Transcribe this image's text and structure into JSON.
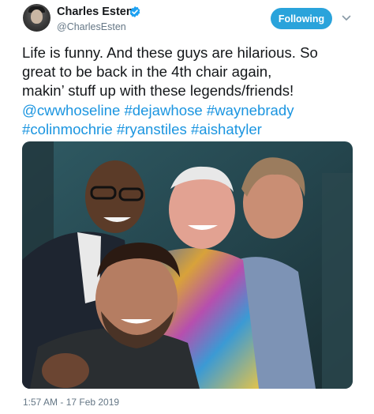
{
  "author": {
    "display_name": "Charles Esten",
    "handle": "@CharlesEsten",
    "verified": true
  },
  "follow_button_label": "Following",
  "tweet": {
    "lines": [
      [
        {
          "text": "Life is funny. And these guys are hilarious. So",
          "tag": false
        }
      ],
      [
        {
          "text": "great to be back in the 4th chair again,",
          "tag": false
        }
      ],
      [
        {
          "text": "makin’ stuff up with these legends/friends!",
          "tag": false
        }
      ],
      [
        {
          "text": "@cwwhoseline",
          "tag": true
        },
        {
          "text": " ",
          "tag": false
        },
        {
          "text": "#dejawhose",
          "tag": true
        },
        {
          "text": " ",
          "tag": false
        },
        {
          "text": "#waynebrady",
          "tag": true
        }
      ],
      [
        {
          "text": "#colinmochrie",
          "tag": true
        },
        {
          "text": " ",
          "tag": false
        },
        {
          "text": "#ryanstiles",
          "tag": true
        },
        {
          "text": " ",
          "tag": false
        },
        {
          "text": "#aishatyler",
          "tag": true
        }
      ]
    ]
  },
  "timestamp": "1:57 AM - 17 Feb 2019",
  "colors": {
    "link": "#1b95e0",
    "follow_bg": "#2aa3db",
    "verified": "#1da1f2",
    "muted": "#657786"
  },
  "icons": {
    "verified": "verified-badge-icon",
    "more": "chevron-down-icon"
  }
}
